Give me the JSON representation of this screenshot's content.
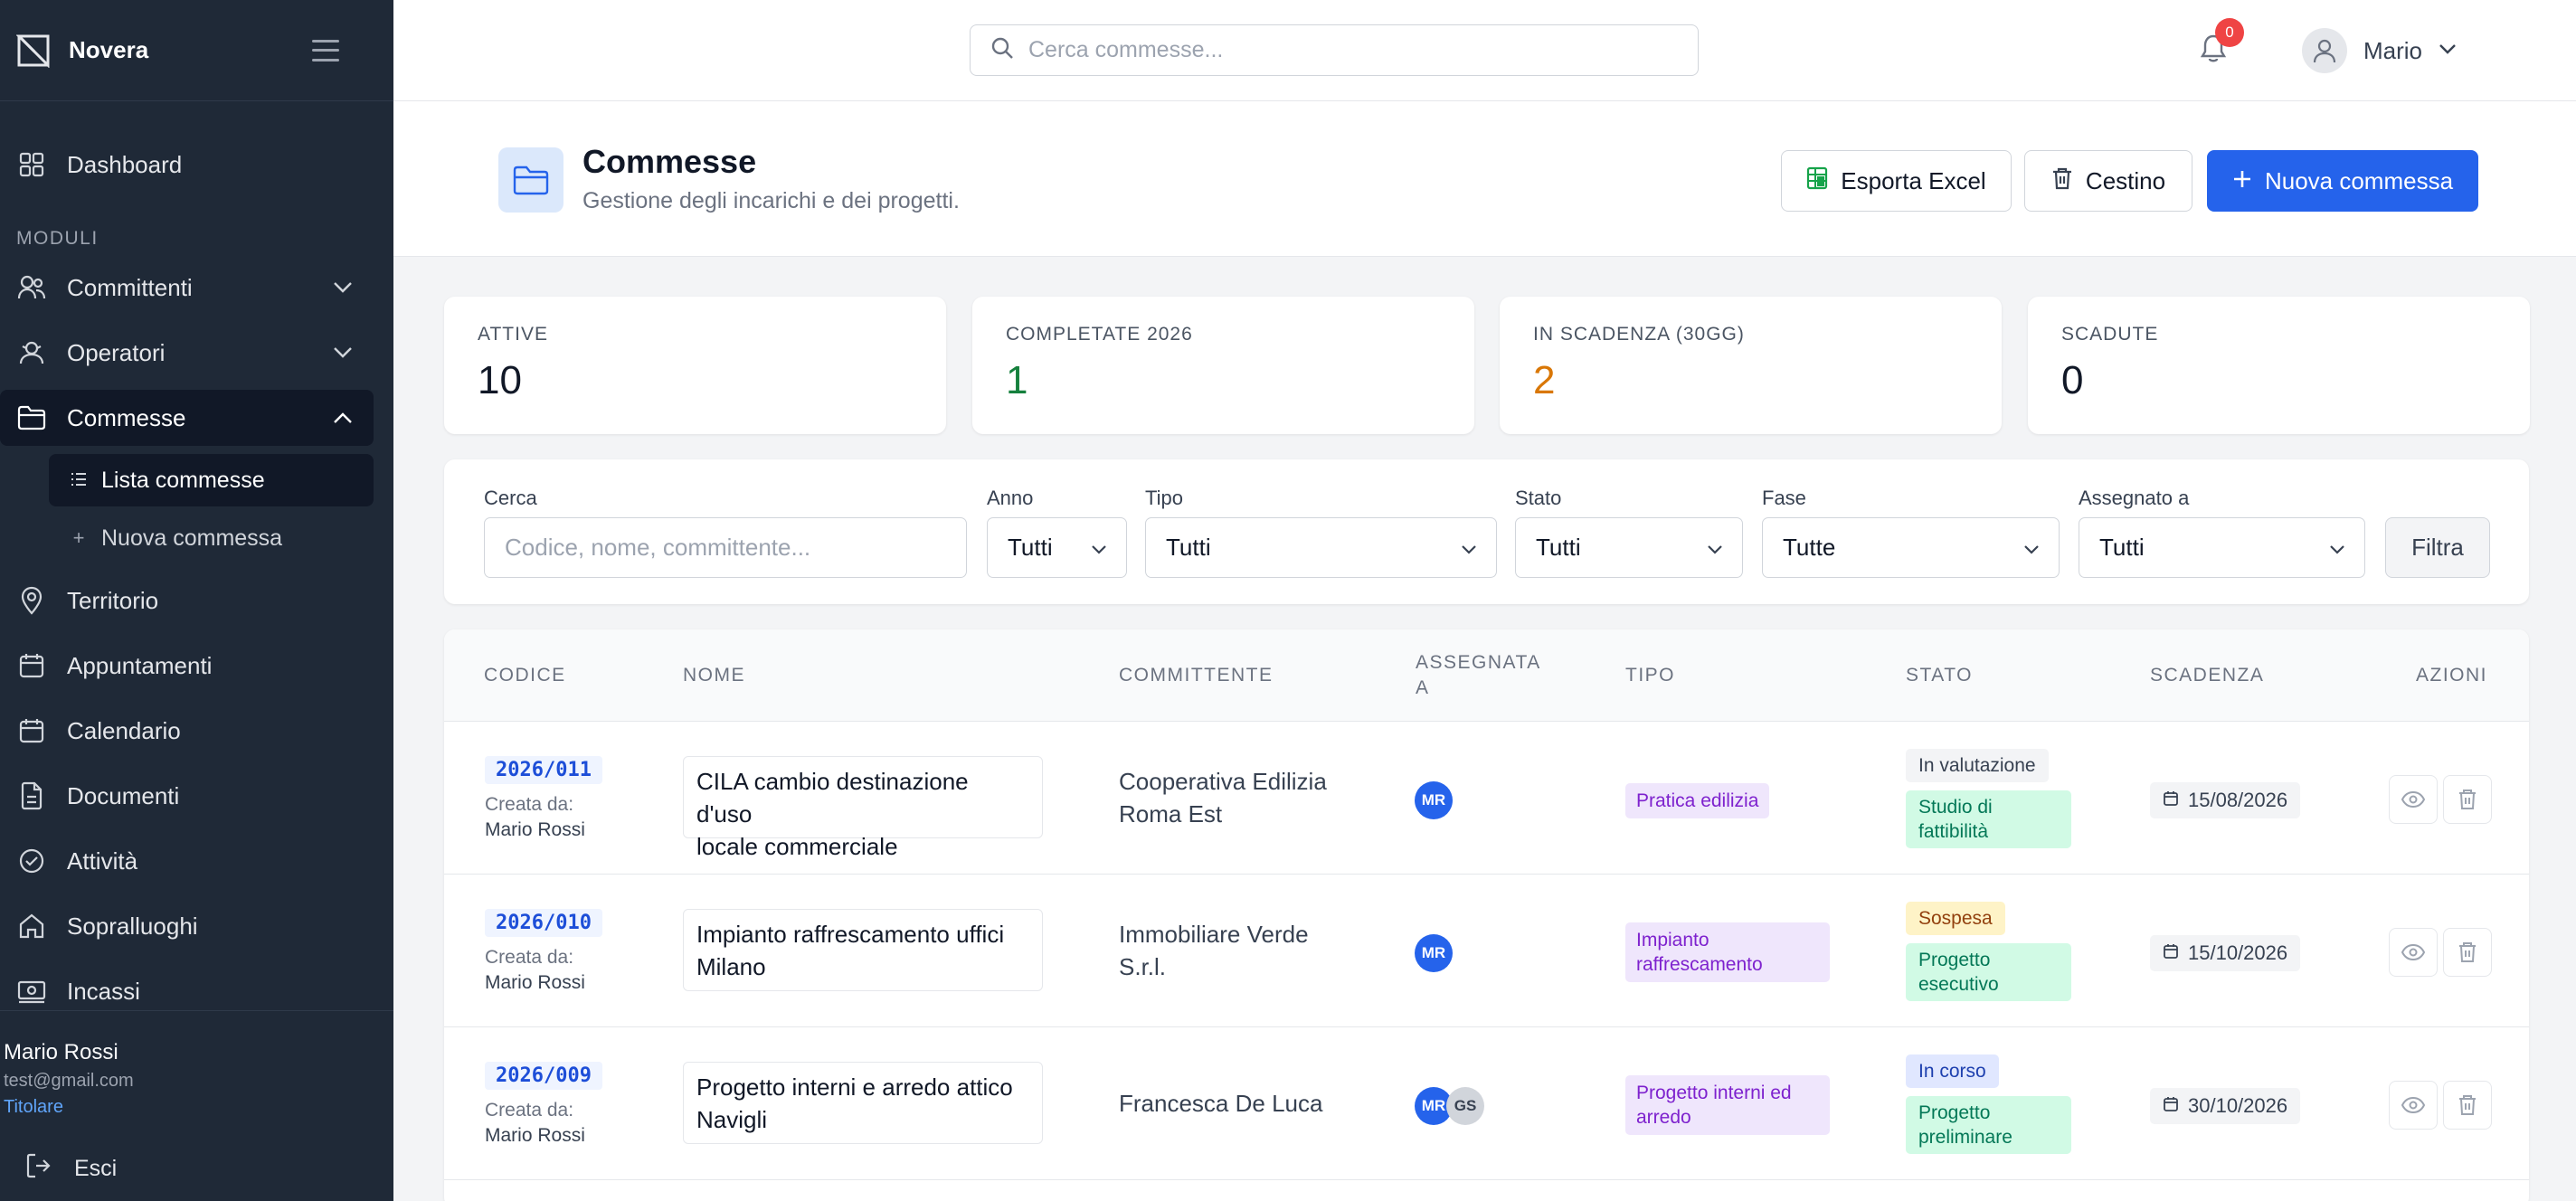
{
  "app": {
    "name": "Novera"
  },
  "sidebar": {
    "dashboard": "Dashboard",
    "section": "MODULI",
    "items": {
      "committenti": "Committenti",
      "operatori": "Operatori",
      "commesse": "Commesse",
      "lista": "Lista commesse",
      "nuova": "Nuova commessa",
      "territorio": "Territorio",
      "appuntamenti": "Appuntamenti",
      "calendario": "Calendario",
      "documenti": "Documenti",
      "attivita": "Attività",
      "sopralluoghi": "Sopralluoghi",
      "incassi": "Incassi"
    },
    "user": {
      "name": "Mario Rossi",
      "email": "test@gmail.com",
      "role": "Titolare"
    },
    "logout": "Esci"
  },
  "topbar": {
    "search_placeholder": "Cerca commesse...",
    "notifications": "0",
    "user": "Mario"
  },
  "header": {
    "title": "Commesse",
    "subtitle": "Gestione degli incarichi e dei progetti.",
    "export": "Esporta Excel",
    "trash": "Cestino",
    "new": "Nuova commessa"
  },
  "stats": [
    {
      "label": "ATTIVE",
      "value": "10",
      "color": "#111827"
    },
    {
      "label": "COMPLETATE 2026",
      "value": "1",
      "color": "#15803d"
    },
    {
      "label": "IN SCADENZA (30GG)",
      "value": "2",
      "color": "#d97706"
    },
    {
      "label": "SCADUTE",
      "value": "0",
      "color": "#111827"
    }
  ],
  "filters": {
    "search_label": "Cerca",
    "search_placeholder": "Codice, nome, committente...",
    "anno_label": "Anno",
    "anno_value": "Tutti",
    "tipo_label": "Tipo",
    "tipo_value": "Tutti",
    "stato_label": "Stato",
    "stato_value": "Tutti",
    "fase_label": "Fase",
    "fase_value": "Tutte",
    "assegnato_label": "Assegnato a",
    "assegnato_value": "Tutti",
    "button": "Filtra"
  },
  "table": {
    "headers": {
      "codice": "CODICE",
      "nome": "NOME",
      "committente": "COMMITTENTE",
      "assegnata_1": "ASSEGNATA",
      "assegnata_2": "A",
      "tipo": "TIPO",
      "stato": "STATO",
      "scadenza": "SCADENZA",
      "azioni": "AZIONI"
    },
    "created_label": "Creata da:",
    "rows": [
      {
        "codice": "2026/011",
        "creator": "Mario Rossi",
        "nome_1": "CILA cambio destinazione d'uso",
        "nome_2": "locale commerciale",
        "committente_1": "Cooperativa Edilizia",
        "committente_2": "Roma Est",
        "assignees": [
          "MR"
        ],
        "tipo_1": "Pratica edilizia",
        "tipo_2": "",
        "stato": "In valutazione",
        "fase_1": "Studio di",
        "fase_2": "fattibilità",
        "scadenza": "15/08/2026"
      },
      {
        "codice": "2026/010",
        "creator": "Mario Rossi",
        "nome_1": "Impianto raffrescamento uffici",
        "nome_2": "Milano",
        "committente_1": "Immobiliare Verde",
        "committente_2": "S.r.l.",
        "assignees": [
          "MR"
        ],
        "tipo_1": "Impianto",
        "tipo_2": "raffrescamento",
        "stato": "Sospesa",
        "fase_1": "Progetto",
        "fase_2": "esecutivo",
        "scadenza": "15/10/2026"
      },
      {
        "codice": "2026/009",
        "creator": "Mario Rossi",
        "nome_1": "Progetto interni e arredo attico",
        "nome_2": "Navigli",
        "committente_1": "Francesca De Luca",
        "committente_2": "",
        "assignees": [
          "MR",
          "GS"
        ],
        "tipo_1": "Progetto interni ed",
        "tipo_2": "arredo",
        "stato": "In corso",
        "fase_1": "Progetto",
        "fase_2": "preliminare",
        "scadenza": "30/10/2026"
      }
    ]
  },
  "colors": {
    "accent": "#2563eb",
    "sidebar": "#1f2937",
    "badge": "#ef4444"
  }
}
